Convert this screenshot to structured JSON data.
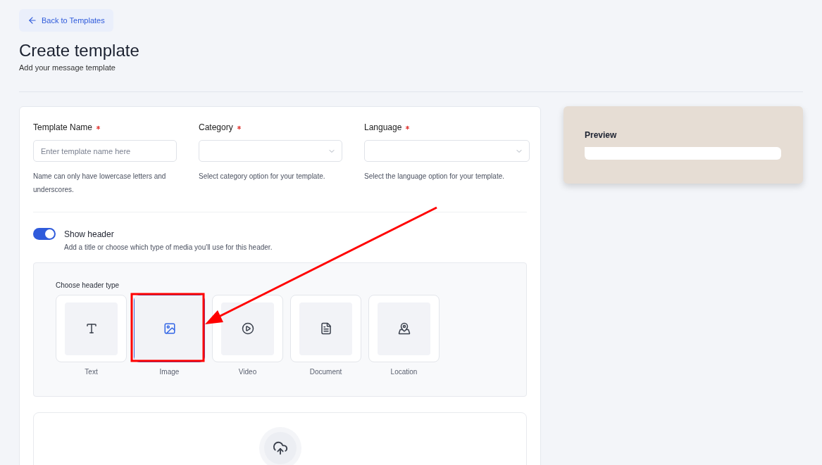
{
  "back_button": {
    "label": "Back to Templates"
  },
  "page": {
    "title": "Create template",
    "subtitle": "Add your message template"
  },
  "fields": [
    {
      "kind": "text",
      "label": "Template Name",
      "required": true,
      "placeholder": "Enter template name here",
      "help": "Name can only have lowercase letters and underscores."
    },
    {
      "kind": "select",
      "label": "Category",
      "required": true,
      "help": "Select category option for your template."
    },
    {
      "kind": "select",
      "label": "Language",
      "required": true,
      "help": "Select the language option for your template."
    }
  ],
  "show_header": {
    "label": "Show header",
    "on": true,
    "description": "Add a title or choose which type of media you'll use for this header."
  },
  "header_type": {
    "label": "Choose header type",
    "options": [
      {
        "kind": "text",
        "label": "Text",
        "selected": false
      },
      {
        "kind": "image",
        "label": "Image",
        "selected": true
      },
      {
        "kind": "video",
        "label": "Video",
        "selected": false
      },
      {
        "kind": "document",
        "label": "Document",
        "selected": false
      },
      {
        "kind": "location",
        "label": "Location",
        "selected": false
      }
    ]
  },
  "preview": {
    "title": "Preview"
  }
}
